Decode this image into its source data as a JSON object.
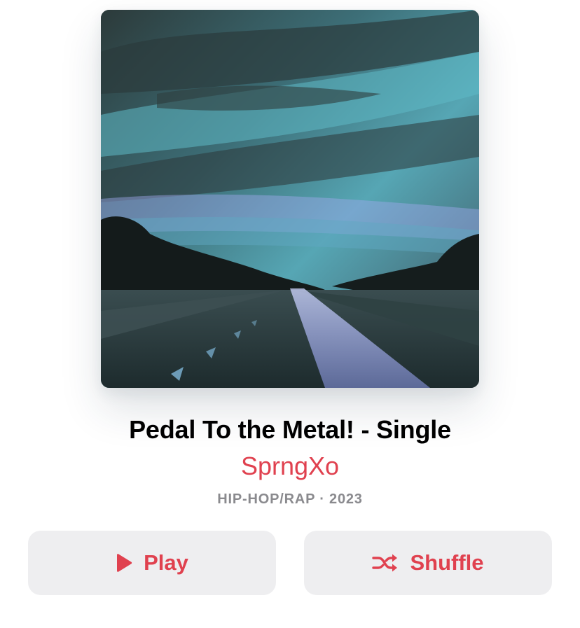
{
  "album": {
    "title": "Pedal To the Metal! - Single",
    "artist": "SprngXo",
    "meta": "HIP-HOP/RAP · 2023"
  },
  "actions": {
    "play_label": "Play",
    "play_icon": "play-icon",
    "shuffle_label": "Shuffle",
    "shuffle_icon": "shuffle-icon"
  },
  "colors": {
    "accent": "#e0414f",
    "button_bg": "#eeeef0",
    "meta_text": "#8a8a8e"
  }
}
